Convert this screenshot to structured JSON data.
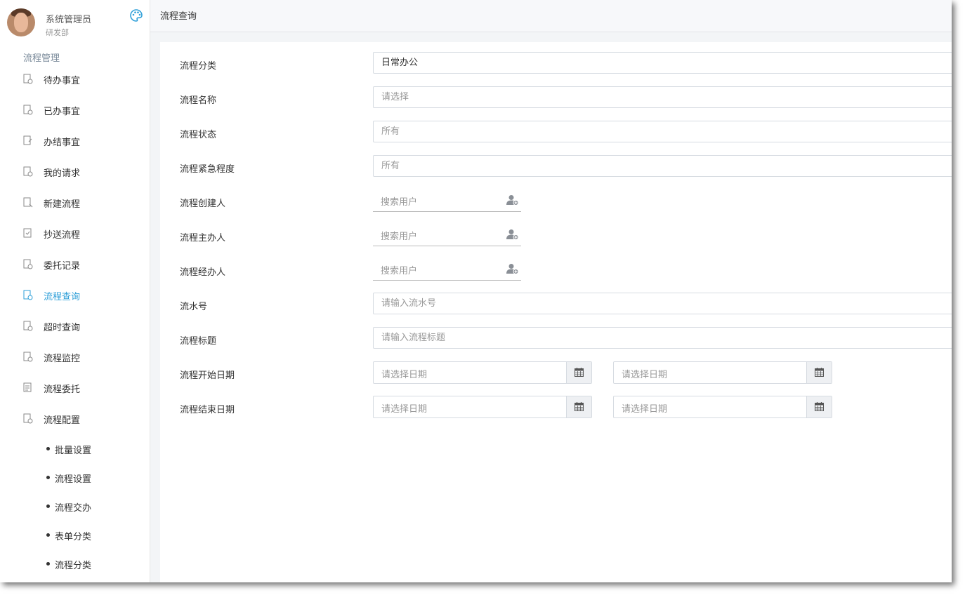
{
  "user": {
    "name": "系统管理员",
    "dept": "研发部"
  },
  "sidebar": {
    "section_title": "流程管理",
    "items": [
      {
        "label": "待办事宜"
      },
      {
        "label": "已办事宜"
      },
      {
        "label": "办结事宜"
      },
      {
        "label": "我的请求"
      },
      {
        "label": "新建流程"
      },
      {
        "label": "抄送流程"
      },
      {
        "label": "委托记录"
      },
      {
        "label": "流程查询",
        "active": true
      },
      {
        "label": "超时查询"
      },
      {
        "label": "流程监控"
      },
      {
        "label": "流程委托"
      },
      {
        "label": "流程配置"
      }
    ],
    "subitems": [
      {
        "label": "批量设置"
      },
      {
        "label": "流程设置"
      },
      {
        "label": "流程交办"
      },
      {
        "label": "表单分类"
      },
      {
        "label": "流程分类"
      }
    ]
  },
  "topbar": {
    "title": "流程查询"
  },
  "form": {
    "category": {
      "label": "流程分类",
      "value": "日常办公"
    },
    "name": {
      "label": "流程名称",
      "value": "请选择"
    },
    "status": {
      "label": "流程状态",
      "value": "所有"
    },
    "urgency": {
      "label": "流程紧急程度",
      "value": "所有"
    },
    "creator": {
      "label": "流程创建人",
      "placeholder": "搜索用户"
    },
    "owner": {
      "label": "流程主办人",
      "placeholder": "搜索用户"
    },
    "handler": {
      "label": "流程经办人",
      "placeholder": "搜索用户"
    },
    "serial": {
      "label": "流水号",
      "placeholder": "请输入流水号"
    },
    "title": {
      "label": "流程标题",
      "placeholder": "请输入流程标题"
    },
    "start_date": {
      "label": "流程开始日期",
      "from_placeholder": "请选择日期",
      "to_placeholder": "请选择日期"
    },
    "end_date": {
      "label": "流程结束日期",
      "from_placeholder": "请选择日期",
      "to_placeholder": "请选择日期"
    }
  },
  "colors": {
    "accent": "#2e9fd8",
    "border": "#d6dbe1",
    "background": "#f3f5f7"
  }
}
